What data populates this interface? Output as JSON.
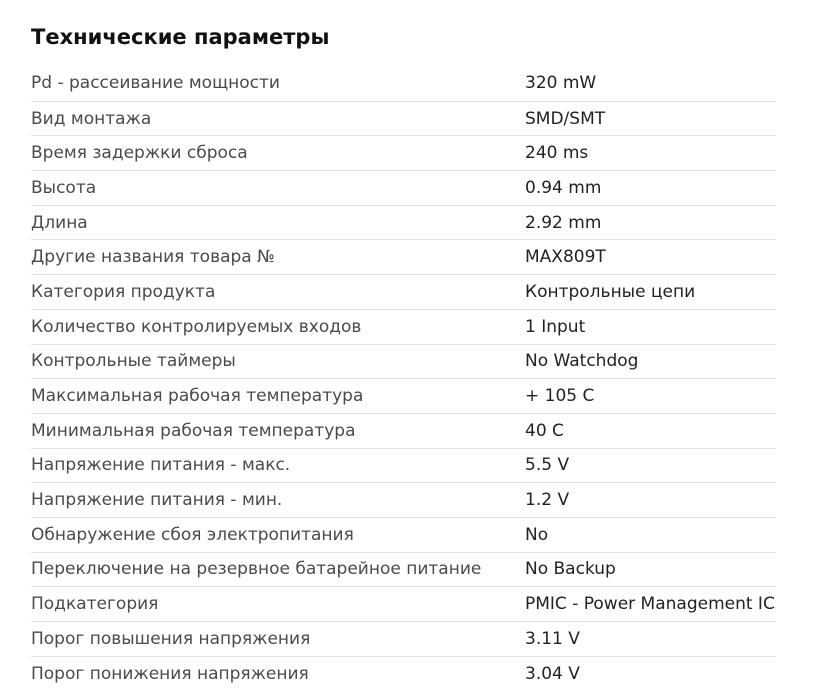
{
  "section": {
    "title": "Технические параметры"
  },
  "specs": [
    {
      "name": "Pd - рассеивание мощности",
      "value": "320 mW"
    },
    {
      "name": "Вид монтажа",
      "value": "SMD/SMT"
    },
    {
      "name": "Время задержки сброса",
      "value": "240 ms"
    },
    {
      "name": "Высота",
      "value": "0.94 mm"
    },
    {
      "name": "Длина",
      "value": "2.92 mm"
    },
    {
      "name": "Другие названия товара №",
      "value": "MAX809T"
    },
    {
      "name": "Категория продукта",
      "value": "Контрольные цепи"
    },
    {
      "name": "Количество контролируемых входов",
      "value": "1 Input"
    },
    {
      "name": "Контрольные таймеры",
      "value": "No Watchdog"
    },
    {
      "name": "Максимальная рабочая температура",
      "value": "+ 105 C"
    },
    {
      "name": "Минимальная рабочая температура",
      "value": "40 C"
    },
    {
      "name": "Напряжение питания - макс.",
      "value": "5.5 V"
    },
    {
      "name": "Напряжение питания - мин.",
      "value": "1.2 V"
    },
    {
      "name": "Обнаружение сбоя электропитания",
      "value": "No"
    },
    {
      "name": "Переключение на резервное батарейное питание",
      "value": "No Backup"
    },
    {
      "name": "Подкатегория",
      "value": "PMIC - Power Management ICs"
    },
    {
      "name": "Порог повышения напряжения",
      "value": "3.11 V"
    },
    {
      "name": "Порог понижения напряжения",
      "value": "3.04 V"
    }
  ]
}
